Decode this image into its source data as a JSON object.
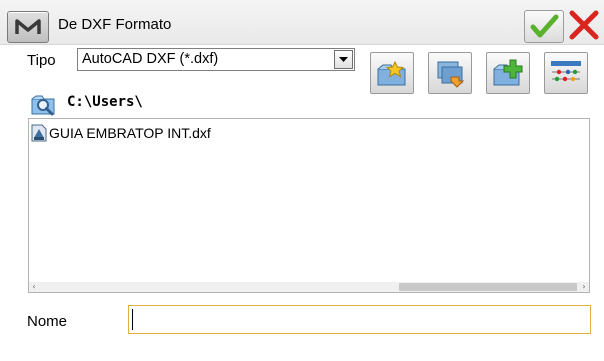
{
  "window": {
    "title": "De DXF Formato",
    "logo_icon": "m-logo-icon",
    "ok_icon": "checkmark-icon",
    "close_icon": "close-x-icon"
  },
  "tipo": {
    "label": "Tipo",
    "selected": "AutoCAD DXF (*.dxf)"
  },
  "toolbar": {
    "buttons": [
      {
        "icon": "favorite-folder-icon"
      },
      {
        "icon": "folders-icon"
      },
      {
        "icon": "new-folder-icon"
      },
      {
        "icon": "layers-settings-icon"
      }
    ]
  },
  "path": {
    "icon": "search-folder-icon",
    "text": "C:\\Users\\"
  },
  "files": [
    {
      "name": "GUIA EMBRATOP INT.dxf",
      "icon": "dxf-file-icon"
    }
  ],
  "nome": {
    "label": "Nome",
    "value": ""
  },
  "colors": {
    "accent_check": "#5ab22c",
    "close_red": "#d9251d",
    "input_border": "#e0b040"
  }
}
